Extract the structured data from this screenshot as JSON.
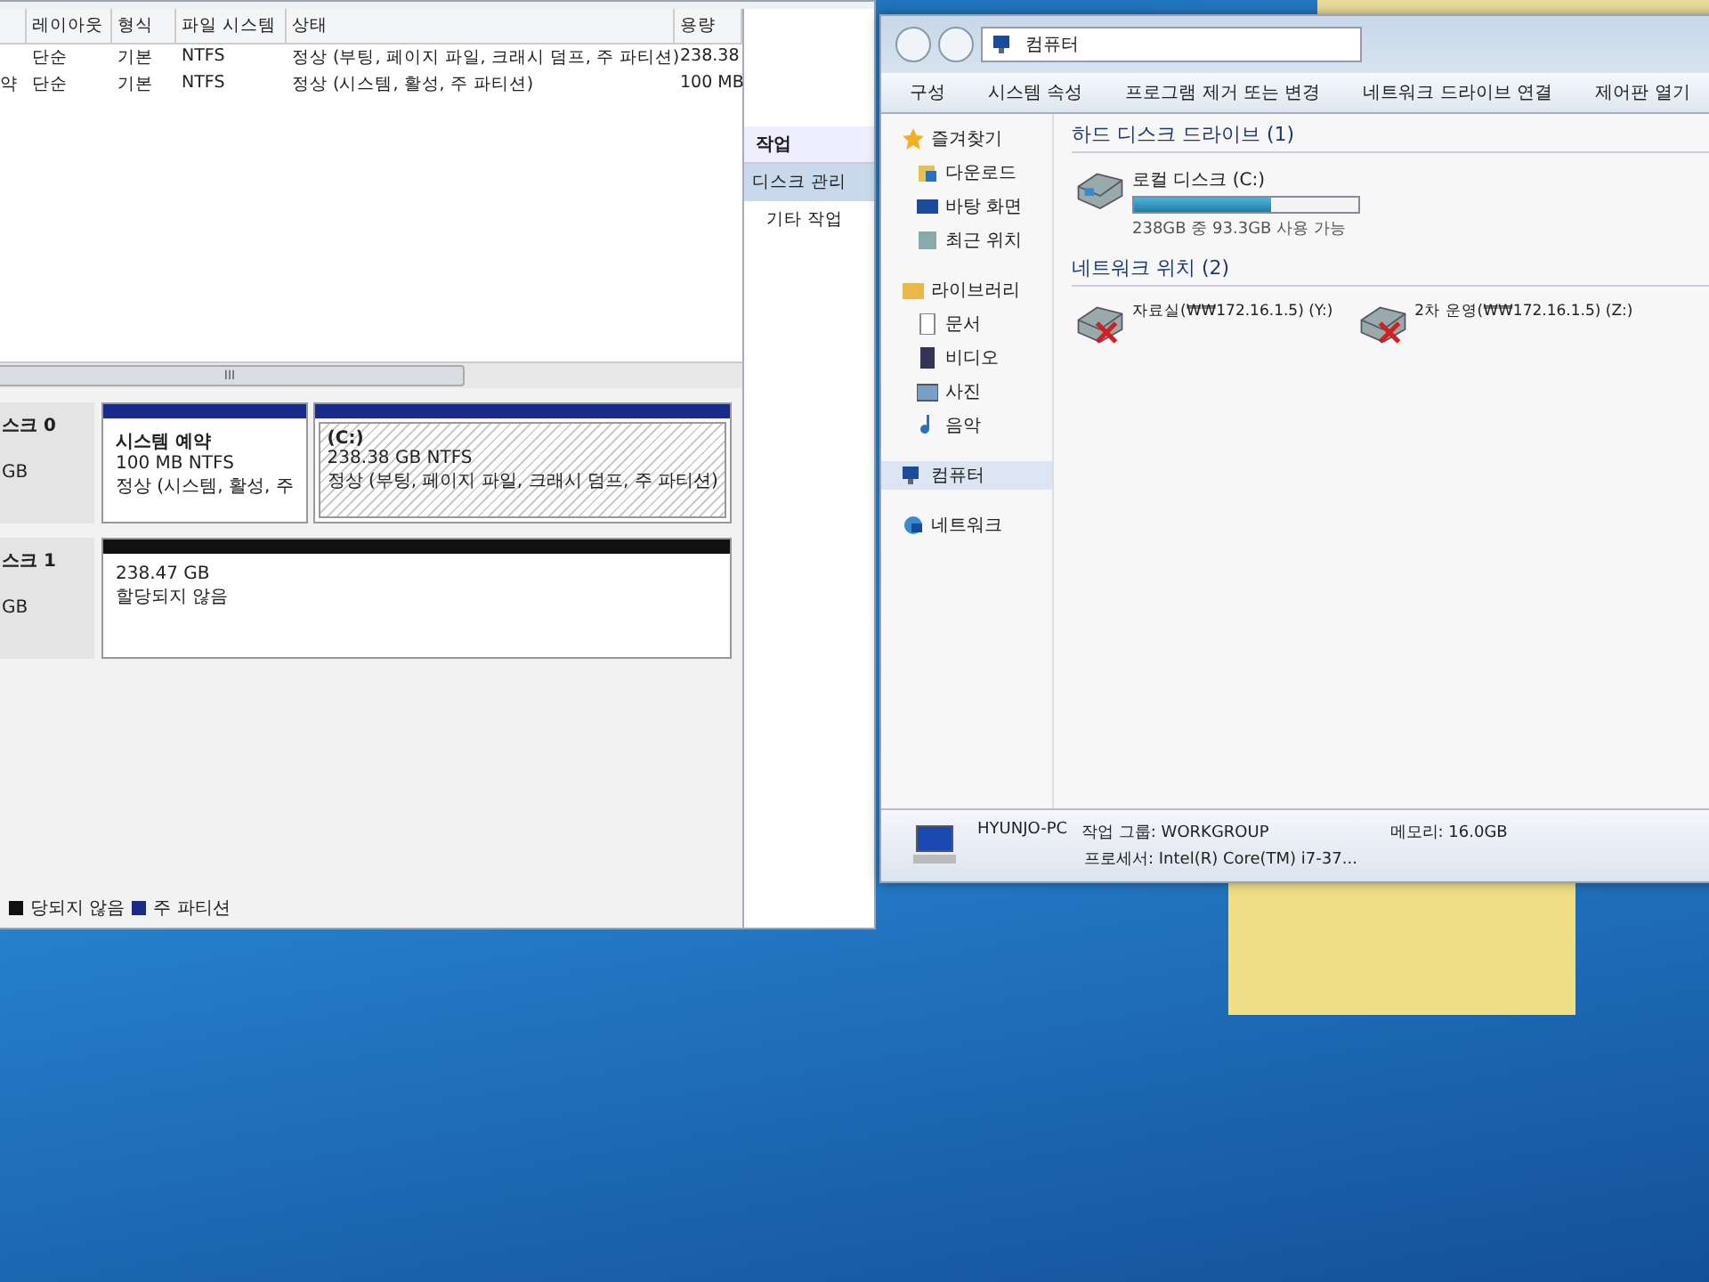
{
  "disk_management": {
    "columns": [
      "",
      "레이아웃",
      "형식",
      "파일 시스템",
      "상태",
      "용량"
    ],
    "rows": [
      {
        "cells": [
          "",
          "단순",
          "기본",
          "NTFS",
          "정상 (부팅, 페이지 파일, 크래시 덤프, 주 파티션)",
          "238.38"
        ]
      },
      {
        "cells": [
          "약",
          "단순",
          "기본",
          "NTFS",
          "정상 (시스템, 활성, 주 파티션)",
          "100 MB"
        ]
      }
    ],
    "scroll_grip": "III",
    "actions": {
      "title": "작업",
      "items": [
        {
          "label": "디스크 관리",
          "selected": true
        },
        {
          "label": "기타 작업",
          "selected": false
        }
      ]
    },
    "disks": [
      {
        "name": "스크 0",
        "size": "GB",
        "partitions": [
          {
            "kind": "primary",
            "title": "시스템 예약",
            "size": "100 MB NTFS",
            "status": "정상 (시스템, 활성, 주",
            "selected": false
          },
          {
            "kind": "primary",
            "title": "(C:)",
            "size": "238.38 GB NTFS",
            "status": "정상 (부팅, 페이지 파일, 크래시 덤프, 주 파티션)",
            "selected": true
          }
        ]
      },
      {
        "name": "스크 1",
        "size": "GB",
        "partitions": [
          {
            "kind": "unallocated",
            "size": "238.47 GB",
            "status": "할당되지 않음",
            "selected": false
          }
        ]
      }
    ],
    "legend": [
      {
        "label": "당되지 않음",
        "color": "#111111"
      },
      {
        "label": "주 파티션",
        "color": "#1a2a8a"
      }
    ]
  },
  "explorer": {
    "breadcrumb": "컴퓨터",
    "toolbar": [
      "구성",
      "시스템 속성",
      "프로그램 제거 또는 변경",
      "네트워크 드라이브 연결",
      "제어판 열기"
    ],
    "sidebar": [
      {
        "label": "즐겨찾기",
        "selected": false,
        "children": [
          {
            "label": "다운로드",
            "selected": false
          },
          {
            "label": "바탕 화면",
            "selected": false
          },
          {
            "label": "최근 위치",
            "selected": false
          }
        ]
      },
      {
        "label": "라이브러리",
        "selected": false,
        "children": [
          {
            "label": "문서",
            "selected": false
          },
          {
            "label": "비디오",
            "selected": false
          },
          {
            "label": "사진",
            "selected": false
          },
          {
            "label": "음악",
            "selected": false
          }
        ]
      },
      {
        "label": "컴퓨터",
        "selected": true
      },
      {
        "label": "네트워크",
        "selected": false
      }
    ],
    "groups": [
      {
        "title": "하드 디스크 드라이브 (1)",
        "items": [
          {
            "kind": "disk",
            "name": "로컬 디스크 (C:)",
            "level": 0.61,
            "caption": "238GB 중 93.3GB 사용 가능"
          }
        ]
      },
      {
        "title": "네트워크 위치 (2)",
        "items": [
          {
            "kind": "network",
            "name": "자료실(₩₩172.16.1.5) (Y:)"
          },
          {
            "kind": "network",
            "name": "2차 운영(₩₩172.16.1.5) (Z:)"
          }
        ]
      }
    ],
    "details": {
      "name": "HYUNJO-PC",
      "workgroup": "작업 그룹: WORKGROUP",
      "memory": "메모리: 16.0GB",
      "processor": "프로세서: Intel(R) Core(TM) i7-37..."
    }
  }
}
